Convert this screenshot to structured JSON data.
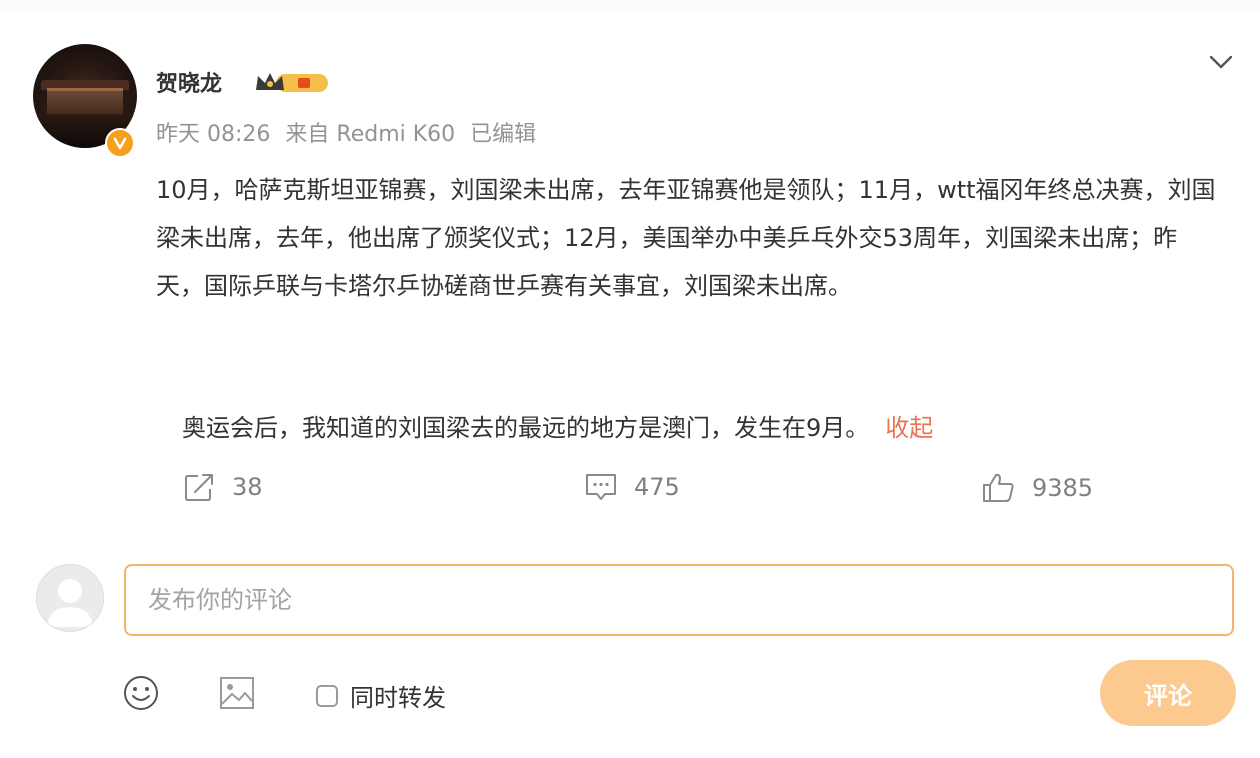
{
  "post": {
    "username": "贺晓龙",
    "meta_time": "昨天 08:26",
    "meta_source": "来自 Redmi K60",
    "meta_edited": "已编辑",
    "body_line_1": "10月，哈萨克斯坦亚锦赛，刘国梁未出席，去年亚锦赛他是领队；11月，wtt福冈年终总决赛，刘国梁未出席，去年，他出席了颁奖仪式；12月，美国举办中美乒乓外交53周年，刘国梁未出席；昨天，国际乒联与卡塔尔乒协磋商世乒赛有关事宜，刘国梁未出席。",
    "body_line_2": "奥运会后，我知道的刘国梁去的最远的地方是澳门，发生在9月。",
    "collapse_label": "收起"
  },
  "actions": {
    "repost_count": "38",
    "comment_count": "475",
    "like_count": "9385"
  },
  "composer": {
    "placeholder": "发布你的评论",
    "repost_checkbox_label": "同时转发",
    "submit_label": "评论"
  },
  "colors": {
    "accent": "#eb7350",
    "submit_bg": "#fcc98f",
    "input_border": "#f3b56b",
    "meta_gray": "#939393",
    "verified_badge": "#f4a01c"
  }
}
